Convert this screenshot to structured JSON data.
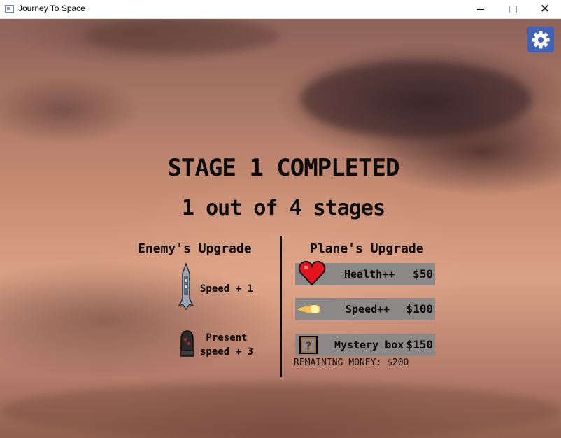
{
  "window": {
    "title": "Journey To Space",
    "close_glyph": "✕"
  },
  "settings": {
    "icon": "gear-icon"
  },
  "stage": {
    "title": "STAGE 1 COMPLETED",
    "subtitle": "1 out of 4 stages"
  },
  "enemy": {
    "heading": "Enemy's Upgrade",
    "speed_label": "Speed + 1",
    "present_line1": "Present",
    "present_line2": "speed + 3",
    "rocket_icon": "rocket-icon",
    "bullet_icon": "bullet-icon"
  },
  "plane": {
    "heading": "Plane's Upgrade",
    "items": [
      {
        "icon": "heart-icon",
        "label": "Health++",
        "price": "$50"
      },
      {
        "icon": "fireball-icon",
        "label": "Speed++",
        "price": "$100"
      },
      {
        "icon": "mystery-box-icon",
        "label": "Mystery box",
        "price": "$150"
      }
    ],
    "remaining": "REMAINING MONEY: $200"
  },
  "colors": {
    "settings_bg": "#3f62b8",
    "shop_button_bg": "#8d8888",
    "heart": "#e3141b"
  }
}
